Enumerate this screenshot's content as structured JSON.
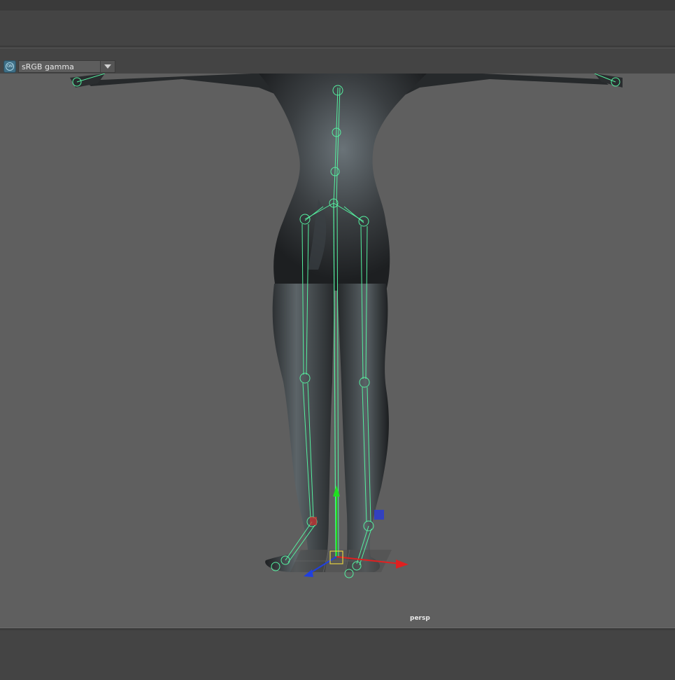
{
  "viewport_bar": {
    "color_management_icon": "color-management-icon",
    "color_management_enabled": true,
    "color_space": "sRGB gamma",
    "dropdown_icon": "chevron-down-icon"
  },
  "viewport": {
    "camera_label": "persp",
    "background_color": "#5f5f5f",
    "joint_color": "#55f0a0",
    "mesh_color": "#2a2c2e"
  },
  "manipulator": {
    "x_axis_color": "#e02020",
    "y_axis_color": "#20e020",
    "z_axis_color": "#2040e0",
    "selection_color": "#e6d040"
  }
}
